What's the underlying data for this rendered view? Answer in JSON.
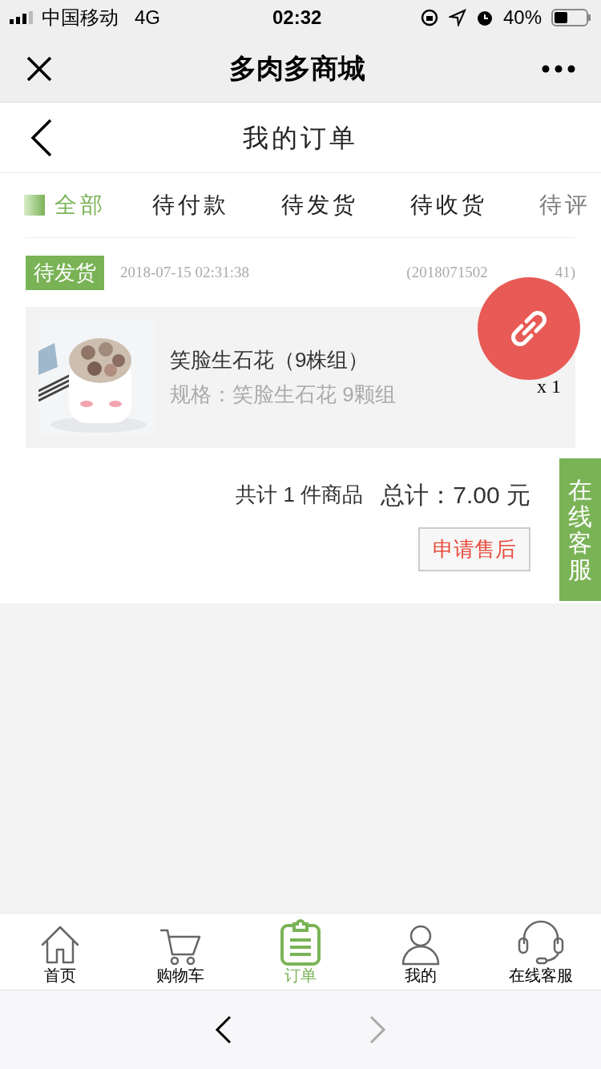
{
  "status_bar": {
    "carrier": "中国移动",
    "network": "4G",
    "time": "02:32",
    "battery": "40%"
  },
  "nav": {
    "title": "多肉多商城"
  },
  "header": {
    "title": "我的订单"
  },
  "tabs": [
    {
      "label": "全部",
      "selected": true
    },
    {
      "label": "待付款",
      "selected": false
    },
    {
      "label": "待发货",
      "selected": false
    },
    {
      "label": "待收货",
      "selected": false
    },
    {
      "label": "待评",
      "selected": false
    }
  ],
  "order": {
    "status": "待发货",
    "time": "2018-07-15 02:31:38",
    "order_no_start": "(2018071502",
    "order_no_end": "41)",
    "item": {
      "name": "笑脸生石花（9株组）",
      "spec": "规格：笑脸生石花 9颗组",
      "qty": "x 1"
    },
    "count": "共计 1 件商品",
    "total": "总计：7.00 元",
    "after_sale": "申请售后"
  },
  "float_service": "在线客服",
  "tab_bar": [
    {
      "label": "首页",
      "kind": "home",
      "selected": false
    },
    {
      "label": "购物车",
      "kind": "cart",
      "selected": false
    },
    {
      "label": "订单",
      "kind": "orders",
      "selected": true
    },
    {
      "label": "我的",
      "kind": "me",
      "selected": false
    },
    {
      "label": "在线客服",
      "kind": "service",
      "selected": false
    }
  ]
}
